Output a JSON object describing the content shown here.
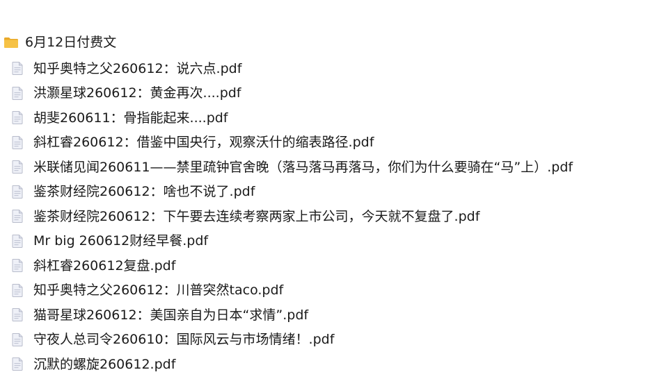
{
  "folder": {
    "name": "6月12日付费文",
    "icon": "folder-icon",
    "color": "#F6C246"
  },
  "files": [
    {
      "name": "知乎奥特之父260612：说六点.pdf",
      "icon": "pdf-file-icon"
    },
    {
      "name": "洪灏星球260612：黄金再次....pdf",
      "icon": "pdf-file-icon"
    },
    {
      "name": "胡斐260611：骨指能起来....pdf",
      "icon": "pdf-file-icon"
    },
    {
      "name": "斜杠睿260612：借鉴中国央行，观察沃什的缩表路径.pdf",
      "icon": "pdf-file-icon"
    },
    {
      "name": "米联储见闻260611——禁里疏钟官舍晚（落马落马再落马，你们为什么要骑在“马”上）.pdf",
      "icon": "pdf-file-icon"
    },
    {
      "name": "鉴茶财经院260612：啥也不说了.pdf",
      "icon": "pdf-file-icon"
    },
    {
      "name": "鉴茶财经院260612：下午要去连续考察两家上市公司，今天就不复盘了.pdf",
      "icon": "pdf-file-icon"
    },
    {
      "name": "Mr big 260612财经早餐.pdf",
      "icon": "pdf-file-icon"
    },
    {
      "name": "斜杠睿260612复盘.pdf",
      "icon": "pdf-file-icon"
    },
    {
      "name": "知乎奥特之父260612：川普突然taco.pdf",
      "icon": "pdf-file-icon"
    },
    {
      "name": "猫哥星球260612：美国亲自为日本“求情”.pdf",
      "icon": "pdf-file-icon"
    },
    {
      "name": "守夜人总司令260610：国际风云与市场情绪！.pdf",
      "icon": "pdf-file-icon"
    },
    {
      "name": "沉默的螺旋260612.pdf",
      "icon": "pdf-file-icon"
    }
  ]
}
